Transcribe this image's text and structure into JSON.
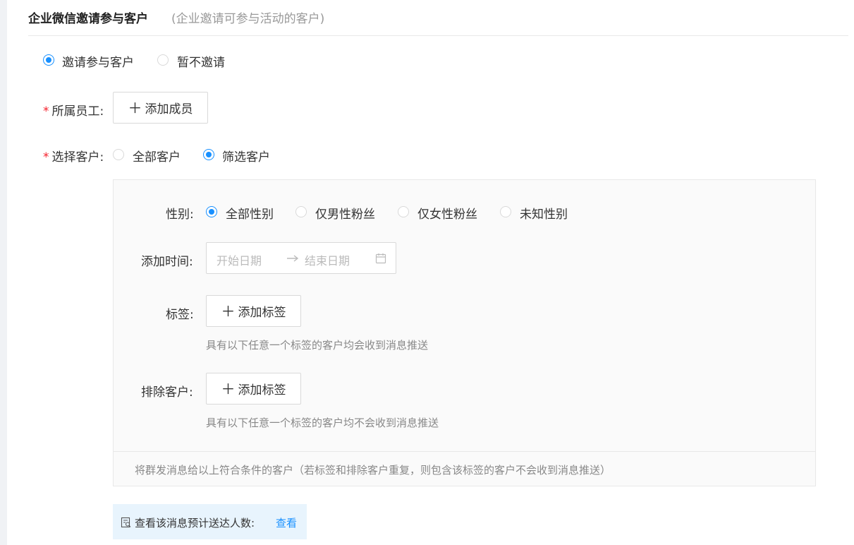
{
  "header": {
    "title": "企业微信邀请参与客户",
    "subtitle": "(企业邀请可参与活动的客户)"
  },
  "invite": {
    "options": [
      {
        "label": "邀请参与客户",
        "checked": true
      },
      {
        "label": "暂不邀请",
        "checked": false
      }
    ]
  },
  "staff": {
    "required_mark": "*",
    "label": "所属员工:",
    "add_button": "添加成员",
    "add_icon": "plus-icon"
  },
  "customers": {
    "required_mark": "*",
    "label": "选择客户:",
    "options": [
      {
        "label": "全部客户",
        "checked": false
      },
      {
        "label": "筛选客户",
        "checked": true
      }
    ]
  },
  "filter": {
    "gender": {
      "label": "性别:",
      "options": [
        {
          "label": "全部性别",
          "checked": true
        },
        {
          "label": "仅男性粉丝",
          "checked": false
        },
        {
          "label": "仅女性粉丝",
          "checked": false
        },
        {
          "label": "未知性别",
          "checked": false
        }
      ]
    },
    "add_time": {
      "label": "添加时间:",
      "start_placeholder": "开始日期",
      "end_placeholder": "结束日期",
      "separator_icon": "arrow-right-icon",
      "calendar_icon": "calendar-icon"
    },
    "tags": {
      "label": "标签:",
      "add_button": "添加标签",
      "hint": "具有以下任意一个标签的客户均会收到消息推送"
    },
    "exclude": {
      "label": "排除客户:",
      "add_button": "添加标签",
      "hint": "具有以下任意一个标签的客户均不会收到消息推送"
    },
    "footer_note": "将群发消息给以上符合条件的客户（若标签和排除客户重复，则包含该标签的客户不会收到消息推送）"
  },
  "estimate": {
    "icon": "search-document-icon",
    "text": "查看该消息预计送达人数:",
    "link": "查看"
  },
  "colors": {
    "accent": "#1890ff",
    "required": "#f5222d",
    "estimate_bg": "#e8f4fd"
  }
}
